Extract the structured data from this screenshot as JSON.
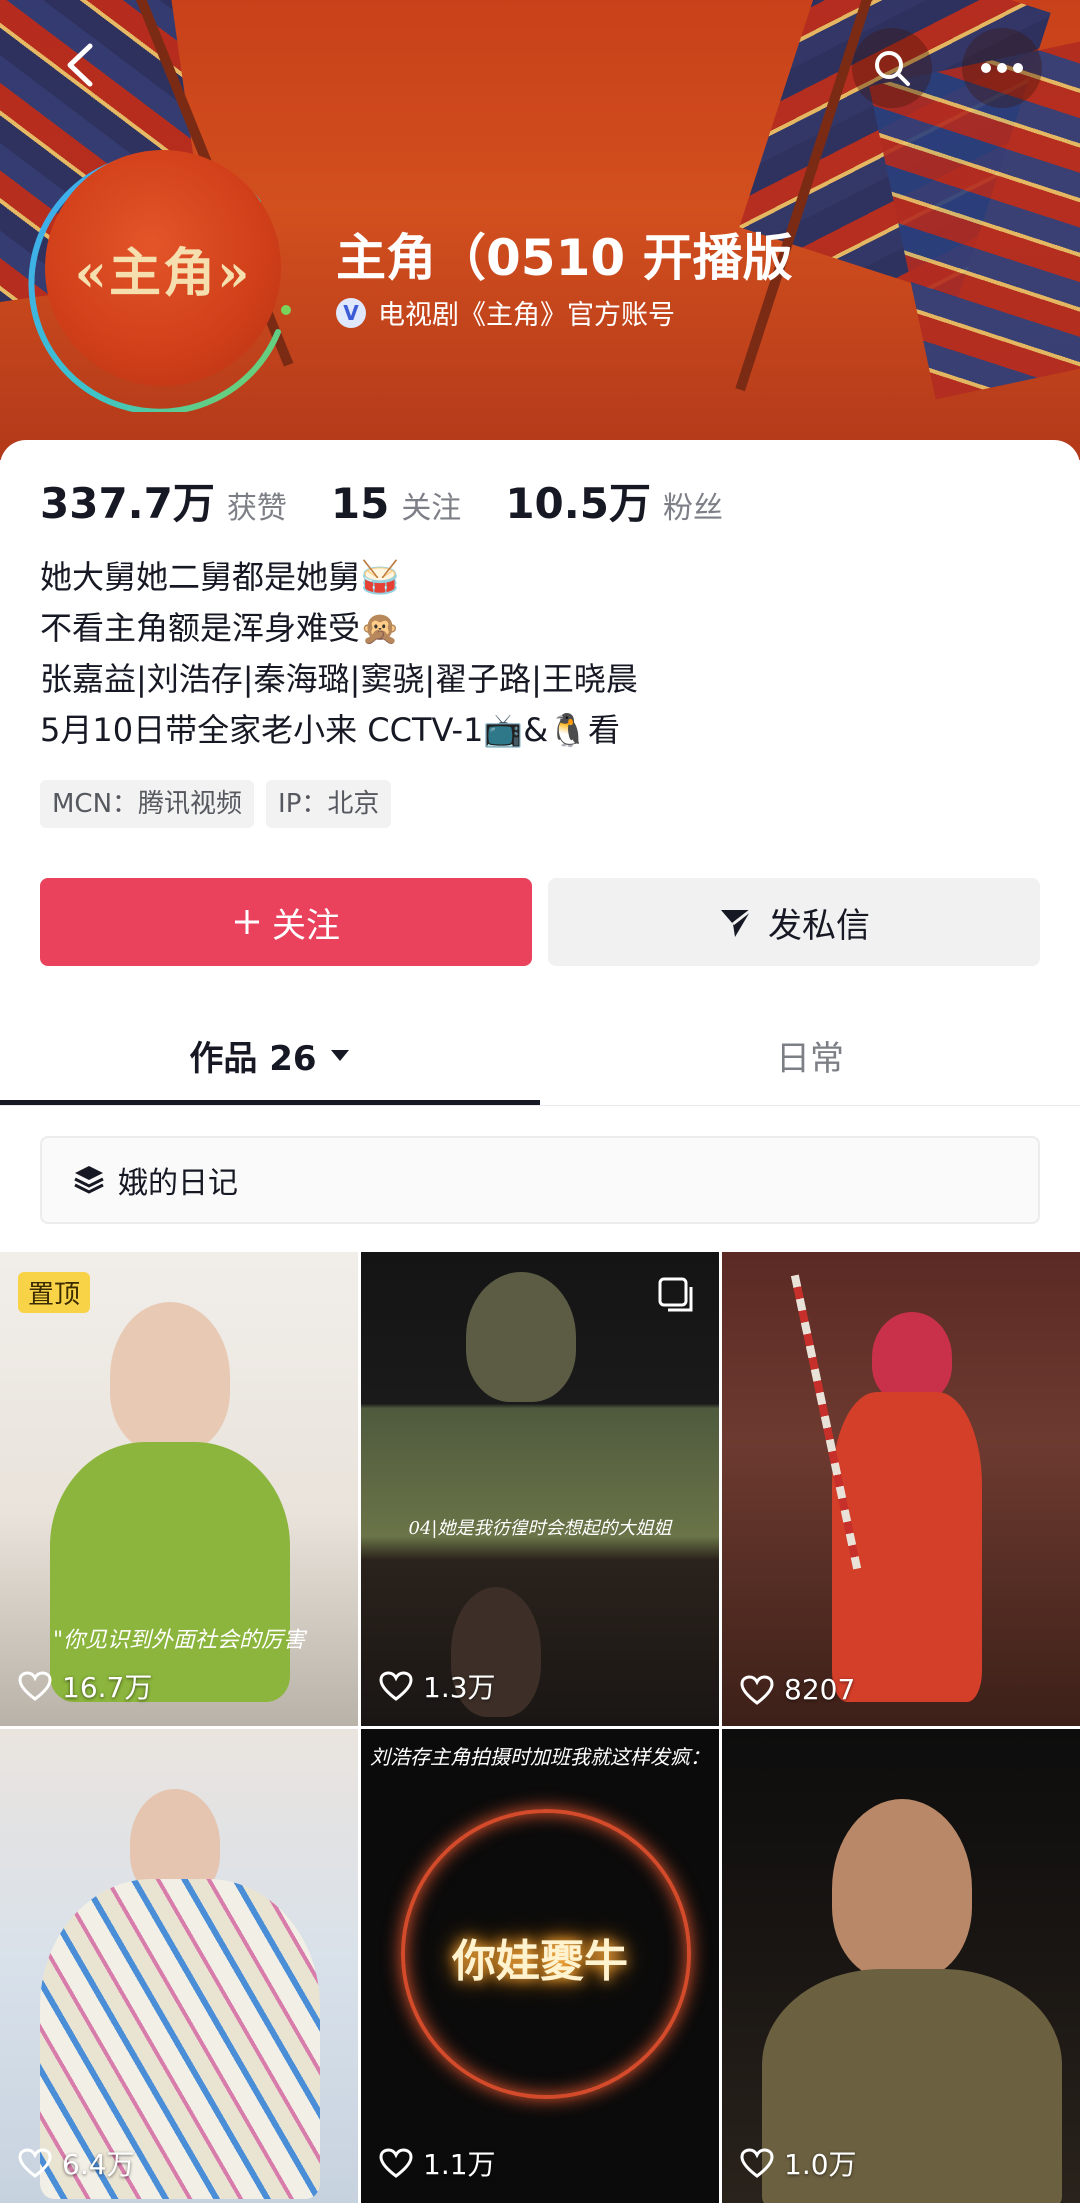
{
  "header": {
    "avatar_text": "«主角»",
    "name": "主角（0510 开播版",
    "verified_badge": "V",
    "verified_text": "电视剧《主角》官方账号"
  },
  "stats": [
    {
      "value": "337.7万",
      "label": "获赞"
    },
    {
      "value": "15",
      "label": "关注"
    },
    {
      "value": "10.5万",
      "label": "粉丝"
    }
  ],
  "bio": [
    "她大舅她二舅都是她舅🥁",
    "不看主角额是浑身难受🙊",
    "张嘉益|刘浩存|秦海璐|窦骁|翟子路|王晓晨",
    "5月10日带全家老小来 CCTV-1📺&🐧看"
  ],
  "tags": [
    "MCN：腾讯视频",
    "IP：北京"
  ],
  "actions": {
    "follow_label": "关注",
    "message_label": "发私信"
  },
  "tabs": {
    "works_label": "作品 26",
    "daily_label": "日常"
  },
  "collection": {
    "label": "娥的日记"
  },
  "videos": [
    {
      "likes": "16.7万",
      "pinned_label": "置顶",
      "caption": "\"你见识到外面社会的厉害"
    },
    {
      "likes": "1.3万",
      "caption": "04|她是我彷徨时会想起的大姐姐"
    },
    {
      "likes": "8207"
    },
    {
      "likes": "6.4万"
    },
    {
      "likes": "1.1万",
      "caption": "刘浩存主角拍摄时加班我就这样发疯：",
      "neon_text": "你娃夒牛"
    },
    {
      "likes": "1.0万"
    }
  ],
  "colors": {
    "accent": "#ea425c",
    "header_bg": "#c8411a",
    "pinned_badge": "#f8d348"
  }
}
